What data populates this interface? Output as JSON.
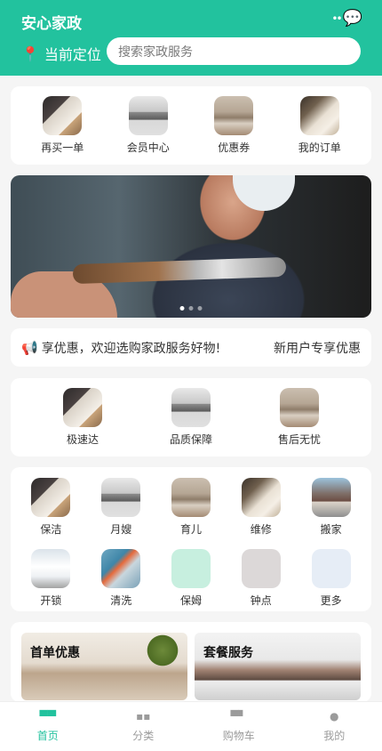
{
  "header": {
    "title": "安心家政",
    "location_label": "当前定位",
    "search_placeholder": "搜索家政服务",
    "icons": [
      "more-dots-icon",
      "chat-icon",
      "location-pin-icon"
    ]
  },
  "quick_entries": [
    {
      "label": "再买一单",
      "icon": "repurchase-image"
    },
    {
      "label": "会员中心",
      "icon": "member-image"
    },
    {
      "label": "优惠券",
      "icon": "coupon-image"
    },
    {
      "label": "我的订单",
      "icon": "orders-image"
    }
  ],
  "banner": {
    "dots": 3,
    "active_dot": 1
  },
  "notice": {
    "text": "享优惠，欢迎选购家政服务好物!",
    "right_text": "新用户专享优惠"
  },
  "features": [
    {
      "label": "极速达"
    },
    {
      "label": "品质保障"
    },
    {
      "label": "售后无忧"
    }
  ],
  "categories": [
    {
      "label": "保洁"
    },
    {
      "label": "月嫂"
    },
    {
      "label": "育儿"
    },
    {
      "label": "维修"
    },
    {
      "label": "搬家"
    },
    {
      "label": "开锁"
    },
    {
      "label": "清洗"
    },
    {
      "label": "保姆"
    },
    {
      "label": "钟点"
    },
    {
      "label": "更多"
    }
  ],
  "promos": [
    {
      "title": "首单优惠"
    },
    {
      "title": "套餐服务"
    }
  ],
  "tabbar": {
    "active": "首页",
    "items": [
      {
        "label": "首页",
        "icon": "home-icon"
      },
      {
        "label": "分类",
        "icon": "grid-icon"
      },
      {
        "label": "购物车",
        "icon": "cart-icon"
      },
      {
        "label": "我的",
        "icon": "user-icon"
      }
    ]
  },
  "colors": {
    "primary": "#22c29e",
    "background": "#f5f5f5"
  }
}
